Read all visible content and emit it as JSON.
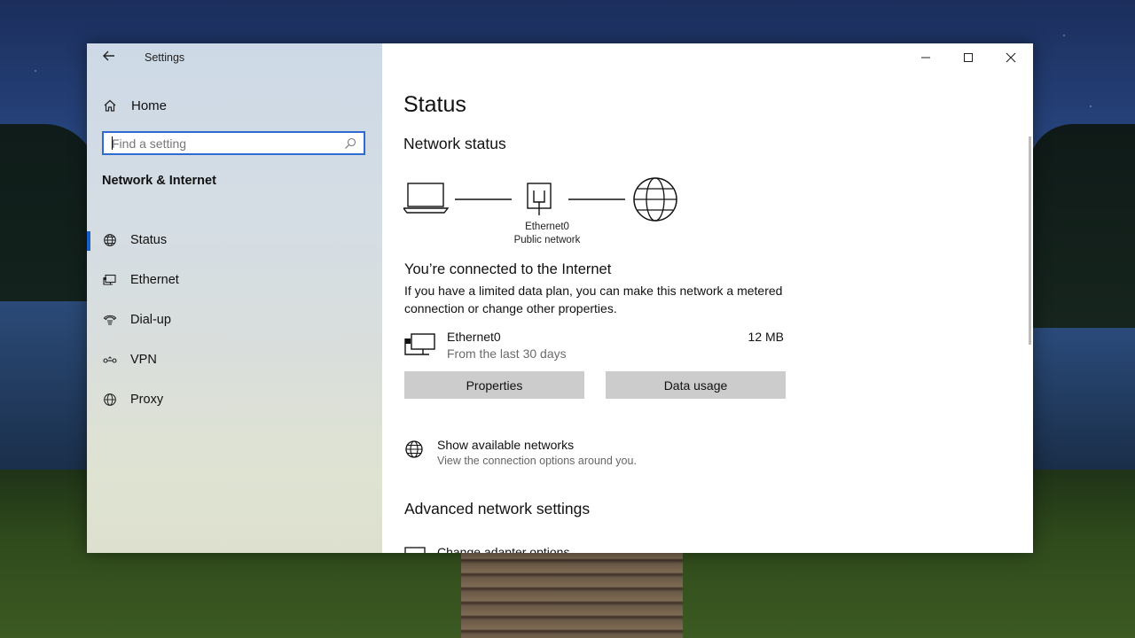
{
  "window": {
    "app_title": "Settings",
    "controls": {
      "minimize": "minimize",
      "maximize": "maximize",
      "close": "close"
    }
  },
  "sidebar": {
    "home_label": "Home",
    "search": {
      "placeholder": "Find a setting"
    },
    "section_title": "Network & Internet",
    "items": [
      {
        "label": "Status",
        "icon": "status-globe-icon",
        "active": true
      },
      {
        "label": "Ethernet",
        "icon": "ethernet-monitor-icon",
        "active": false
      },
      {
        "label": "Dial-up",
        "icon": "dialup-phone-icon",
        "active": false
      },
      {
        "label": "VPN",
        "icon": "vpn-icon",
        "active": false
      },
      {
        "label": "Proxy",
        "icon": "proxy-globe-icon",
        "active": false
      }
    ]
  },
  "main": {
    "page_title": "Status",
    "network_status_title": "Network status",
    "diagram": {
      "adapter_name": "Ethernet0",
      "network_type": "Public network"
    },
    "connected_title": "You’re connected to the Internet",
    "connected_desc": "If you have a limited data plan, you can make this network a metered connection or change other properties.",
    "connection": {
      "name": "Ethernet0",
      "period": "From the last 30 days",
      "usage": "12 MB"
    },
    "buttons": {
      "properties": "Properties",
      "data_usage": "Data usage"
    },
    "show_networks": {
      "title": "Show available networks",
      "subtitle": "View the connection options around you."
    },
    "advanced_title": "Advanced network settings",
    "change_adapter": "Change adapter options"
  }
}
